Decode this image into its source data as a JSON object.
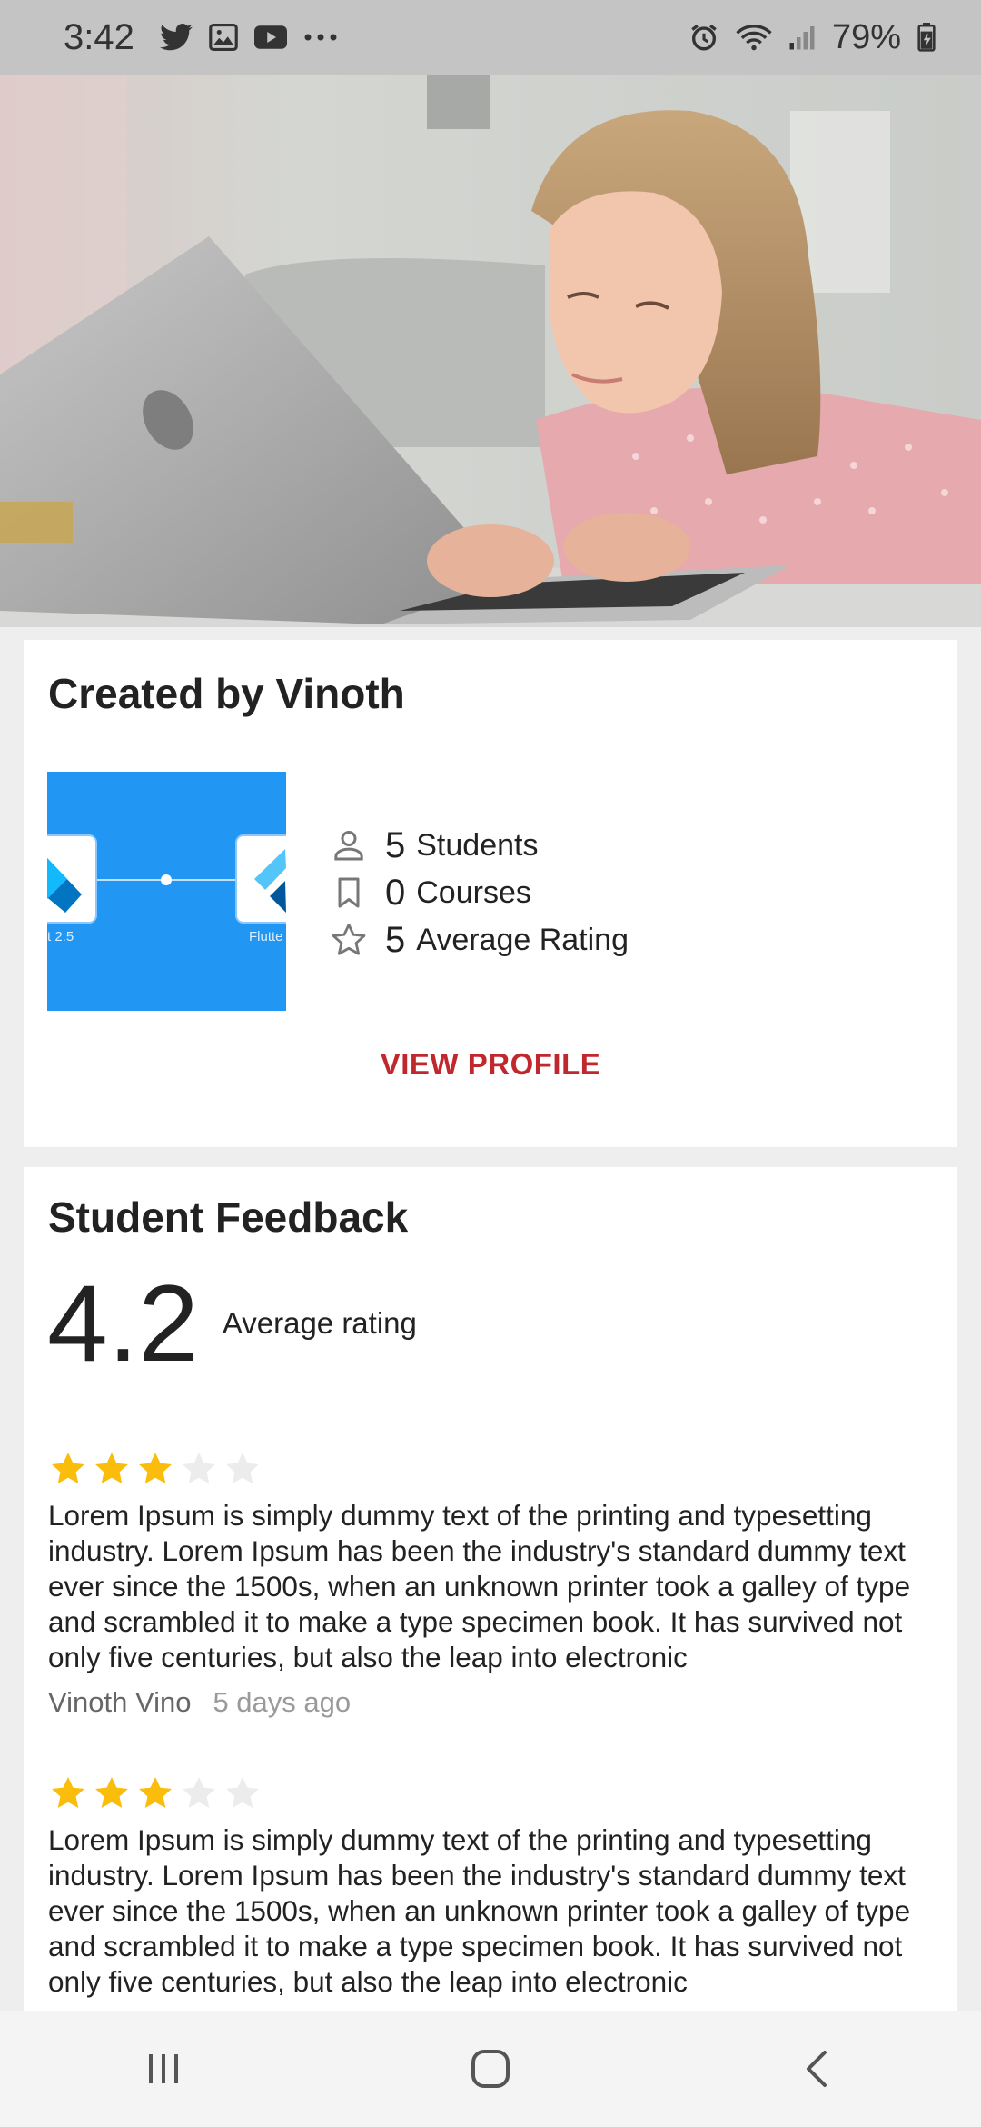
{
  "status_bar": {
    "time": "3:42",
    "left_icons": [
      "twitter-icon",
      "gallery-icon",
      "youtube-icon",
      "more-icon"
    ],
    "right_icons": [
      "alarm-icon",
      "wifi-icon",
      "signal-icon",
      "battery-icon"
    ],
    "battery": "79%"
  },
  "hero": {
    "image": "girl-with-laptop"
  },
  "creator": {
    "title": "Created by Vinoth",
    "thumbnail": {
      "left_caption": "t 2.5",
      "right_caption": "Flutte",
      "color": "#2196f3"
    },
    "stats": [
      {
        "icon": "person-icon",
        "value": "5",
        "label": "Students"
      },
      {
        "icon": "bookmark-icon",
        "value": "0",
        "label": "Courses"
      },
      {
        "icon": "star-outline-icon",
        "value": "5",
        "label": "Average Rating"
      }
    ],
    "view_profile_label": "VIEW PROFILE"
  },
  "feedback": {
    "title": "Student Feedback",
    "average": "4.2",
    "average_label": "Average rating",
    "reviews": [
      {
        "rating": 3,
        "max_rating": 5,
        "text": "Lorem Ipsum is simply dummy text of the printing and typesetting industry. Lorem Ipsum has been the industry's standard dummy text ever since the 1500s, when an unknown printer took a galley of type and scrambled it to make a type specimen book. It has survived not only five centuries, but also the leap into electronic",
        "author": "Vinoth Vino",
        "time": "5 days ago"
      },
      {
        "rating": 3,
        "max_rating": 5,
        "text": "Lorem Ipsum is simply dummy text of the printing and typesetting industry. Lorem Ipsum has been the industry's standard dummy text ever since the 1500s, when an unknown printer took a galley of type and scrambled it to make a type specimen book. It has survived not only five centuries, but also the leap into electronic",
        "author": "",
        "time": ""
      }
    ]
  },
  "colors": {
    "accent_red": "#c0282d",
    "star_filled": "#fbbd0b",
    "star_empty": "#ececec",
    "thumbnail_blue": "#2196f3"
  },
  "nav_bar": {
    "buttons": [
      "recents-icon",
      "home-icon",
      "back-icon"
    ]
  }
}
